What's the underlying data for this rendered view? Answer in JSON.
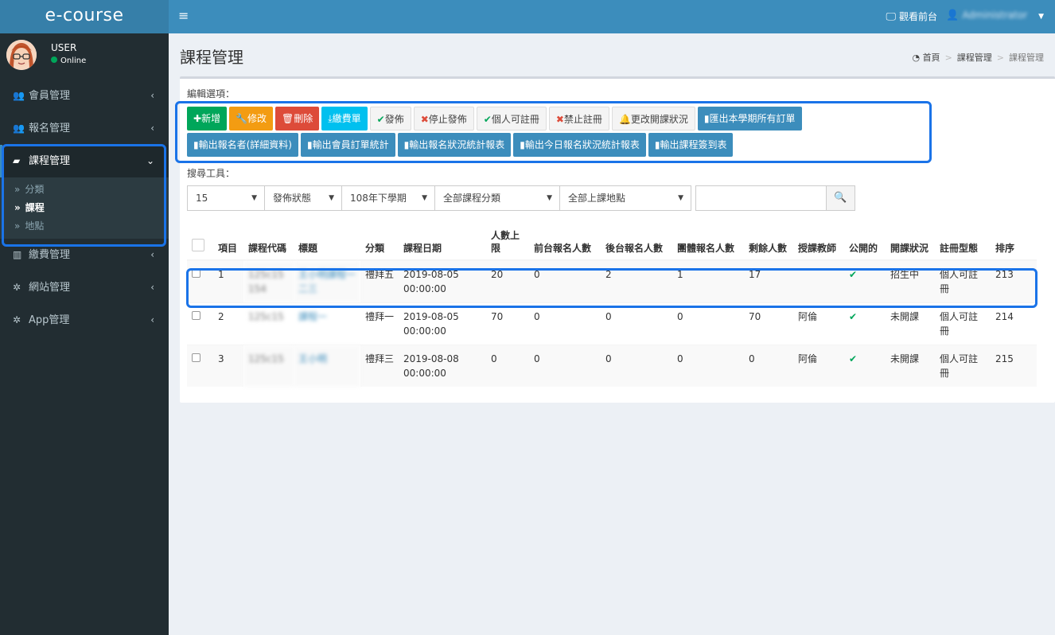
{
  "app": {
    "logo": "e-course"
  },
  "topbar": {
    "menu_toggle": "≡",
    "frontend_link": "觀看前台",
    "user_name": "Administrator"
  },
  "sidebar": {
    "user": {
      "name": "USER",
      "status": "Online"
    },
    "items": [
      {
        "label": "會員管理"
      },
      {
        "label": "報名管理"
      },
      {
        "label": "課程管理"
      },
      {
        "label": "繳費管理"
      },
      {
        "label": "網站管理"
      },
      {
        "label": "App管理"
      }
    ],
    "course_submenu": [
      {
        "label": "分類"
      },
      {
        "label": "課程"
      },
      {
        "label": "地點"
      }
    ]
  },
  "page": {
    "title": "課程管理",
    "breadcrumb": [
      "首頁",
      "課程管理",
      "課程管理"
    ]
  },
  "editor": {
    "label": "編輯選項：",
    "buttons_row1": [
      {
        "label": "新增"
      },
      {
        "label": "修改"
      },
      {
        "label": "刪除"
      },
      {
        "label": "繳費單"
      },
      {
        "label": "發佈"
      },
      {
        "label": "停止發佈"
      },
      {
        "label": "個人可註冊"
      },
      {
        "label": "禁止註冊"
      },
      {
        "label": "更改開課狀況"
      },
      {
        "label": "匯出本學期所有訂單"
      }
    ],
    "buttons_row2": [
      {
        "label": "輸出報名者(詳細資料)"
      },
      {
        "label": "輸出會員訂單統計"
      },
      {
        "label": "輸出報名狀況統計報表"
      },
      {
        "label": "輸出今日報名狀況統計報表"
      },
      {
        "label": "輸出課程簽到表"
      }
    ]
  },
  "search": {
    "label": "搜尋工具：",
    "page_size": "15",
    "publish_status": "發佈狀態",
    "semester": "108年下學期",
    "category": "全部課程分類",
    "location": "全部上課地點",
    "keyword_value": ""
  },
  "table": {
    "headers": [
      "項目",
      "課程代碼",
      "標題",
      "分類",
      "課程日期",
      "人數上限",
      "前台報名人數",
      "後台報名人數",
      "團體報名人數",
      "剩餘人數",
      "授課教師",
      "公開的",
      "開課狀況",
      "註冊型態",
      "排序"
    ],
    "rows": [
      {
        "no": "1",
        "code": "125c15 154",
        "title": "王小明課程一二三",
        "category": "禮拜五",
        "date": "2019-08-05 00:00:00",
        "limit": "20",
        "front": "0",
        "back": "2",
        "group": "1",
        "remain": "17",
        "teacher": "",
        "status": "招生中",
        "reg": "個人可註冊",
        "order": "213"
      },
      {
        "no": "2",
        "code": "125c15",
        "title": "課程一",
        "category": "禮拜一",
        "date": "2019-08-05 00:00:00",
        "limit": "70",
        "front": "0",
        "back": "0",
        "group": "0",
        "remain": "70",
        "teacher": "阿倫",
        "status": "未開課",
        "reg": "個人可註冊",
        "order": "214"
      },
      {
        "no": "3",
        "code": "125c15",
        "title": "王小明",
        "category": "禮拜三",
        "date": "2019-08-08 00:00:00",
        "limit": "0",
        "front": "0",
        "back": "0",
        "group": "0",
        "remain": "0",
        "teacher": "阿倫",
        "status": "未開課",
        "reg": "個人可註冊",
        "order": "215"
      }
    ]
  },
  "colors": {
    "primary": "#3c8dbc",
    "sidebar_bg": "#222d32",
    "success": "#00a65a",
    "warning": "#f39c12",
    "danger": "#dd4b39",
    "info": "#00c0ef",
    "highlight": "#1a73e8"
  }
}
